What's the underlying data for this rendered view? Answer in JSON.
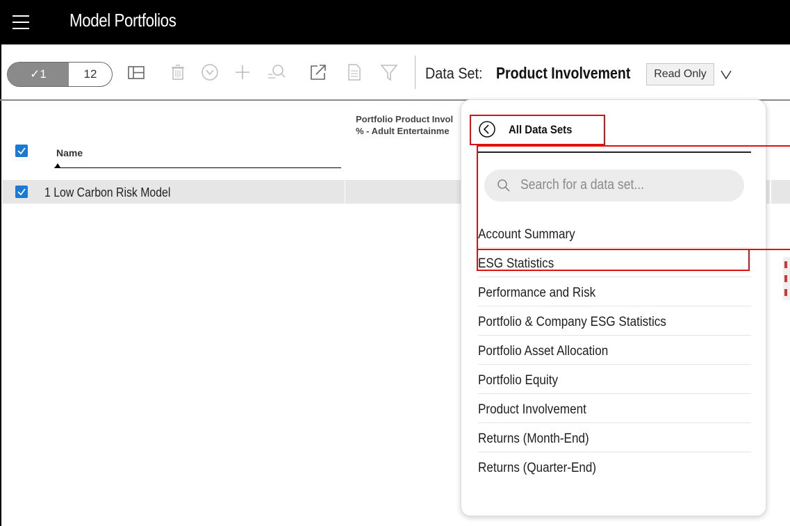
{
  "header": {
    "title": "Model Portfolios"
  },
  "toolbar": {
    "selected_count": "✓1",
    "total_count": "12",
    "data_set_label": "Data Set:",
    "data_set_name": "Product Involvement",
    "read_only_label": "Read Only",
    "icons": [
      "layout-icon",
      "delete-icon",
      "dropdown-circle-icon",
      "add-icon",
      "search-zoom-icon",
      "export-icon",
      "document-icon",
      "filter-icon",
      "chevron-down-icon"
    ]
  },
  "grid": {
    "columns": [
      "Name",
      "Portfolio Product Invol % - Adult Entertainme"
    ],
    "column_pp_line1": "Portfolio Product Invol",
    "column_pp_line2": "% - Adult Entertainme",
    "rows": [
      {
        "label": "1 Low Carbon Risk Model",
        "checked": true
      }
    ]
  },
  "dropdown": {
    "back_label": "All Data Sets",
    "search_placeholder": "Search for a data set...",
    "items": [
      "Account Summary",
      "ESG Statistics",
      "Performance and Risk",
      "Portfolio & Company ESG Statistics",
      "Portfolio Asset Allocation",
      "Portfolio Equity",
      "Product Involvement",
      "Returns (Month-End)",
      "Returns (Quarter-End)"
    ]
  },
  "colors": {
    "header_bg": "#000000",
    "checkbox_blue": "#1a7ad4",
    "row_highlight": "#e6e6e6",
    "annotation_red": "#e01010"
  }
}
